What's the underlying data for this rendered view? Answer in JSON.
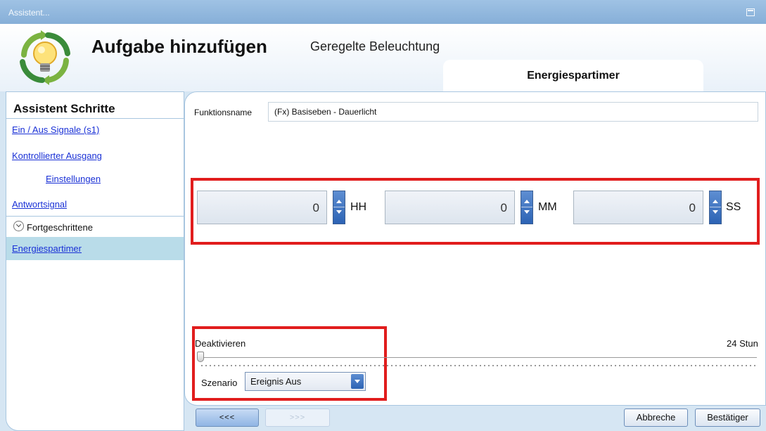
{
  "window": {
    "title": "Assistent..."
  },
  "header": {
    "title": "Aufgabe hinzufügen",
    "subtitle": "Geregelte Beleuchtung",
    "active_tab": "Energiespartimer"
  },
  "sidebar": {
    "heading": "Assistent Schritte",
    "items": [
      {
        "label": "Ein / Aus Signale (s1)"
      },
      {
        "label": "Kontrollierter Ausgang"
      },
      {
        "label": "Einstellungen"
      },
      {
        "label": "Antwortsignal"
      }
    ],
    "section": {
      "label": "Fortgeschrittene"
    },
    "active_item": {
      "label": "Energiespartimer"
    }
  },
  "form": {
    "function_name_label": "Funktionsname",
    "function_name_value": "(Fx) Basiseben - Dauerlicht",
    "hours": {
      "value": "0",
      "unit": "HH"
    },
    "minutes": {
      "value": "0",
      "unit": "MM"
    },
    "seconds": {
      "value": "0",
      "unit": "SS"
    },
    "slider": {
      "min_label": "Deaktivieren",
      "max_label": "24 Stun",
      "value_fraction": 0
    },
    "scenario": {
      "label": "Szenario",
      "value": "Ereignis Aus"
    }
  },
  "footer": {
    "back_label": "<<<",
    "next_label": ">>>",
    "cancel_label": "Abbreche",
    "confirm_label": "Bestätiger"
  },
  "colors": {
    "highlight_box": "#e11d1d",
    "accent_blue": "#2c63b4",
    "link": "#1a31d6",
    "active_row": "#b9dce9"
  }
}
